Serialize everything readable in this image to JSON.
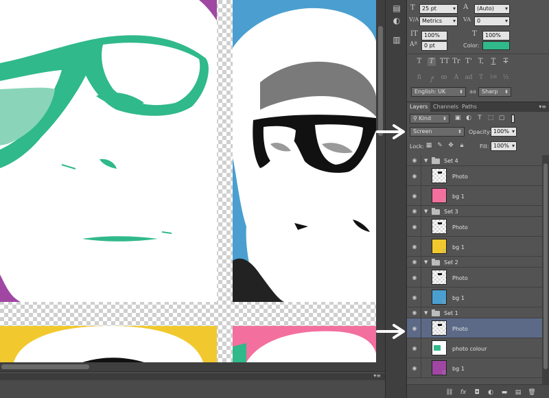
{
  "colors": {
    "accent_green": "#30b98b",
    "blue": "#4a9fd0",
    "pink": "#f36f9e",
    "yellow": "#f1c92e",
    "purple": "#a047a4",
    "selected_row": "#5c6a87"
  },
  "character": {
    "font_size": "25 pt",
    "leading": "(Auto)",
    "kerning": "Metrics",
    "tracking": "0",
    "vertical_scale": "100%",
    "horizontal_scale": "100%",
    "baseline_shift": "0 pt",
    "color_label": "Color:",
    "language": "English: UK",
    "antialias": "Sharp",
    "type_buttons": [
      "T",
      "T",
      "TT",
      "Tr",
      "T'",
      "T,",
      "T",
      "T"
    ],
    "ot_buttons": [
      "fi",
      "ꝭ",
      "ꝏ",
      "A",
      "ad",
      "T",
      "1st",
      "½"
    ]
  },
  "layers": {
    "tabs": [
      "Layers",
      "Channels",
      "Paths"
    ],
    "filter": "Kind",
    "blend_mode": "Screen",
    "opacity_label": "Opacity:",
    "opacity_value": "100%",
    "lock_label": "Lock:",
    "fill_label": "Fill:",
    "fill_value": "100%",
    "rows": [
      {
        "type": "group",
        "name": "Set 4"
      },
      {
        "type": "layer",
        "name": "Photo",
        "thumb": "photo"
      },
      {
        "type": "layer",
        "name": "bg 1",
        "thumb": "pink"
      },
      {
        "type": "group",
        "name": "Set 3"
      },
      {
        "type": "layer",
        "name": "Photo",
        "thumb": "photo"
      },
      {
        "type": "layer",
        "name": "bg 1",
        "thumb": "yellow"
      },
      {
        "type": "group",
        "name": "Set 2"
      },
      {
        "type": "layer",
        "name": "Photo",
        "thumb": "photo"
      },
      {
        "type": "layer",
        "name": "bg 1",
        "thumb": "blue"
      },
      {
        "type": "group",
        "name": "Set 1"
      },
      {
        "type": "layer",
        "name": "Photo",
        "thumb": "photo",
        "selected": true
      },
      {
        "type": "layer",
        "name": "photo colour",
        "thumb": "green"
      },
      {
        "type": "layer",
        "name": "bg 1",
        "thumb": "purple"
      }
    ],
    "footer_icons": [
      "link-icon",
      "fx-icon",
      "mask-icon",
      "adjustment-icon",
      "folder-icon",
      "new-layer-icon",
      "trash-icon"
    ]
  }
}
